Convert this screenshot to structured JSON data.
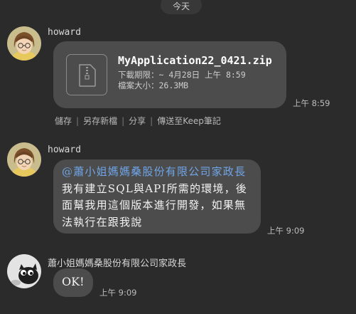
{
  "date_divider": "今天",
  "messages": [
    {
      "sender": "howard",
      "file": {
        "name": "MyApplication22_0421.zip",
        "expiry": "下載期限：~ 4月28日 上午 8:59",
        "size": "檔案大小：26.3MB"
      },
      "time": "上午 8:59",
      "actions": [
        "儲存",
        "另存新檔",
        "分享",
        "傳送至Keep筆記"
      ]
    },
    {
      "sender": "howard",
      "mention": "@蕭小姐媽媽桑股份有限公司家政長",
      "text": " 我有建立SQL與API所需的環境，後面幫我用這個版本進行開發，如果無法執行在跟我說",
      "time": "上午 9:09"
    },
    {
      "sender": "蕭小姐媽媽桑股份有限公司家政長",
      "text": "OK!",
      "time": "上午 9:09"
    }
  ],
  "icons": {
    "file": "zip-file-icon",
    "avatar_1": "cartoon-avatar",
    "avatar_2": "cat-avatar"
  },
  "colors": {
    "background": "#2b2b2b",
    "bubble": "#4c4c4c",
    "mention": "#6fa5e6"
  }
}
